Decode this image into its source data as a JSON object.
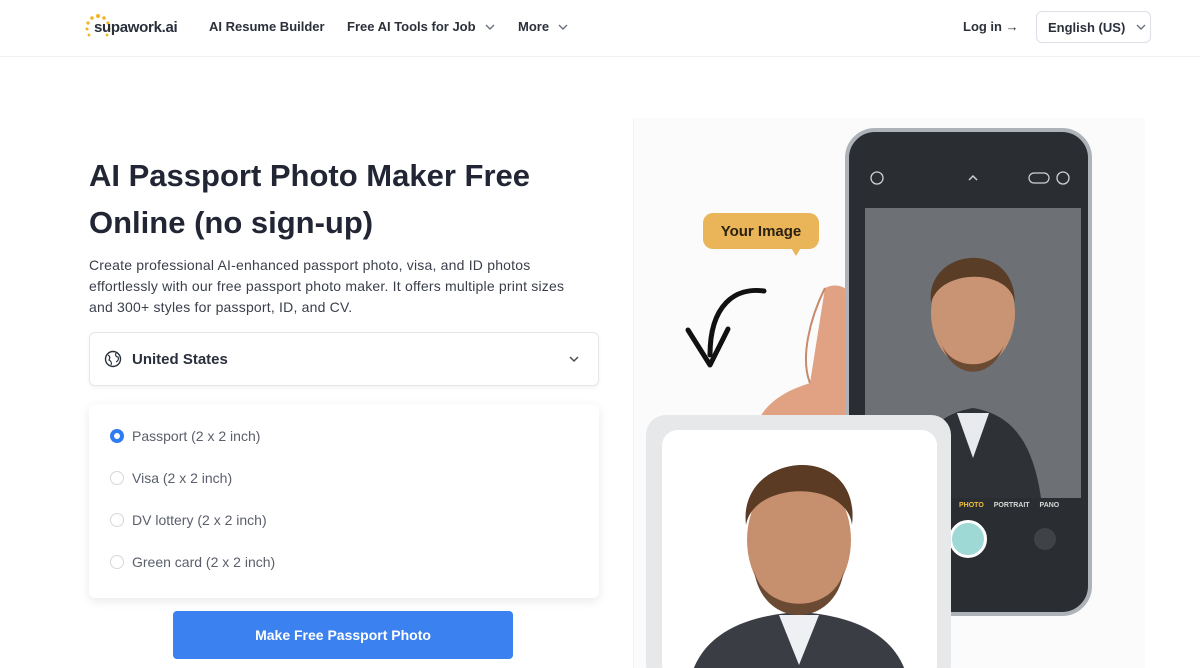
{
  "header": {
    "logo_text": "supawork.ai",
    "nav": [
      {
        "label": "AI Resume Builder"
      },
      {
        "label": "Free AI Tools for Job"
      },
      {
        "label": "More"
      }
    ],
    "login_label": "Log in →",
    "language_label": "English (US)"
  },
  "hero": {
    "title": "AI Passport Photo Maker Free Online (no sign-up)",
    "description": "Create professional AI-enhanced passport photo, visa, and ID photos effortlessly with our free passport photo maker. It offers multiple print sizes and 300+ styles for passport, ID, and CV."
  },
  "country_select": {
    "value": "United States"
  },
  "document_options": [
    {
      "label": "Passport (2 x 2 inch)",
      "selected": true
    },
    {
      "label": "Visa (2 x 2 inch)",
      "selected": false
    },
    {
      "label": "DV lottery (2 x 2 inch)",
      "selected": false
    },
    {
      "label": "Green card (2 x 2 inch)",
      "selected": false
    }
  ],
  "cta_label": "Make Free Passport Photo",
  "illustration": {
    "bubble_text": "Your Image",
    "camera_modes": [
      "PHOTO",
      "PORTRAIT",
      "PANO"
    ]
  },
  "colors": {
    "primary": "#3b82f0",
    "bubble": "#e9b558",
    "text_dark": "#222634"
  }
}
